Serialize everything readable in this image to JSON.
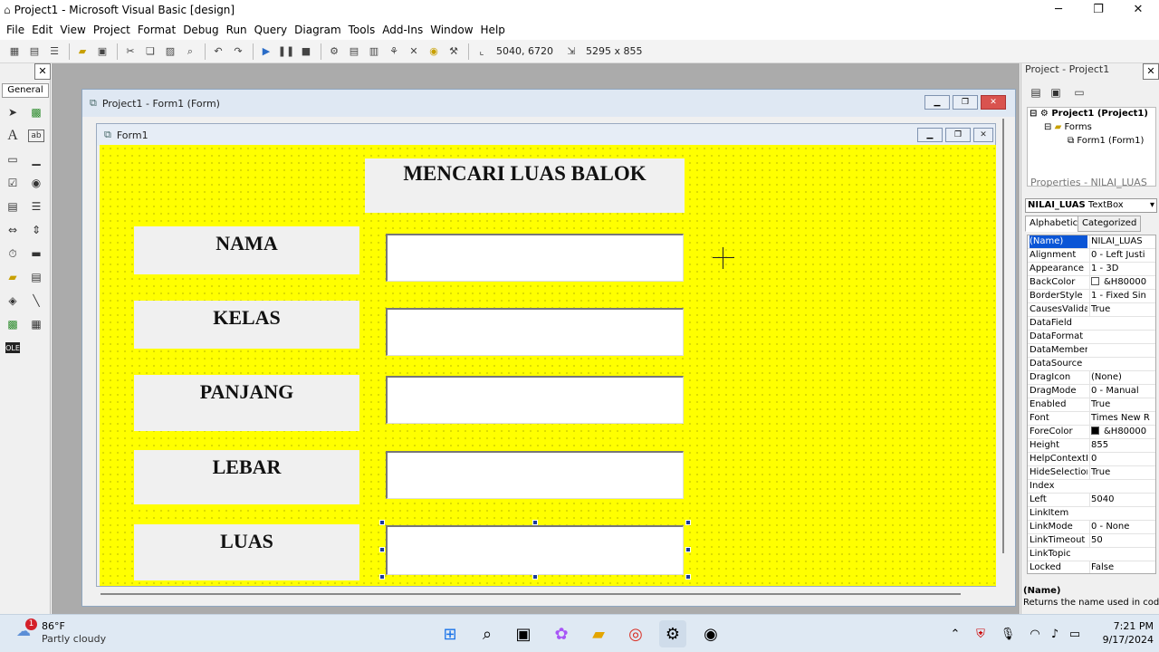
{
  "titlebar": {
    "title": "Project1 - Microsoft Visual Basic [design]",
    "minimize": "─",
    "maximize": "❐",
    "close": "✕"
  },
  "menu": [
    "File",
    "Edit",
    "View",
    "Project",
    "Format",
    "Debug",
    "Run",
    "Query",
    "Diagram",
    "Tools",
    "Add-Ins",
    "Window",
    "Help"
  ],
  "toolbar": {
    "position": "5040, 6720",
    "size": "5295 x 855"
  },
  "toolbox": {
    "tab": "General",
    "close": "✕"
  },
  "project_window": {
    "title": "Project1 - Form1 (Form)"
  },
  "form_window": {
    "title": "Form1"
  },
  "form": {
    "heading": "MENCARI LUAS BALOK",
    "labels": [
      "NAMA",
      "KELAS",
      "PANJANG",
      "LEBAR",
      "LUAS"
    ]
  },
  "project_explorer": {
    "title": "Project - Project1",
    "tree": [
      "Project1 (Project1)",
      "Forms",
      "Form1 (Form1)"
    ]
  },
  "properties": {
    "title": "Properties - NILAI_LUAS",
    "object": "NILAI_LUAS",
    "object_type": "TextBox",
    "tabs": [
      "Alphabetic",
      "Categorized"
    ],
    "rows": [
      {
        "k": "(Name)",
        "v": "NILAI_LUAS"
      },
      {
        "k": "Alignment",
        "v": "0 - Left Justi"
      },
      {
        "k": "Appearance",
        "v": "1 - 3D"
      },
      {
        "k": "BackColor",
        "v": "&H80000"
      },
      {
        "k": "BorderStyle",
        "v": "1 - Fixed Sin"
      },
      {
        "k": "CausesValidat",
        "v": "True"
      },
      {
        "k": "DataField",
        "v": ""
      },
      {
        "k": "DataFormat",
        "v": ""
      },
      {
        "k": "DataMember",
        "v": ""
      },
      {
        "k": "DataSource",
        "v": ""
      },
      {
        "k": "DragIcon",
        "v": "(None)"
      },
      {
        "k": "DragMode",
        "v": "0 - Manual"
      },
      {
        "k": "Enabled",
        "v": "True"
      },
      {
        "k": "Font",
        "v": "Times New R"
      },
      {
        "k": "ForeColor",
        "v": "&H80000"
      },
      {
        "k": "Height",
        "v": "855"
      },
      {
        "k": "HelpContextII",
        "v": "0"
      },
      {
        "k": "HideSelection",
        "v": "True"
      },
      {
        "k": "Index",
        "v": ""
      },
      {
        "k": "Left",
        "v": "5040"
      },
      {
        "k": "LinkItem",
        "v": ""
      },
      {
        "k": "LinkMode",
        "v": "0 - None"
      },
      {
        "k": "LinkTimeout",
        "v": "50"
      },
      {
        "k": "LinkTopic",
        "v": ""
      },
      {
        "k": "Locked",
        "v": "False"
      }
    ],
    "desc_title": "(Name)",
    "desc_text": "Returns the name used in code"
  },
  "taskbar": {
    "weather_temp": "86°F",
    "weather_text": "Partly cloudy",
    "badge": "1",
    "time": "7:21 PM",
    "date": "9/17/2024"
  },
  "colors": {
    "form_back": "#ffff00",
    "selection": "#0a55d6"
  }
}
